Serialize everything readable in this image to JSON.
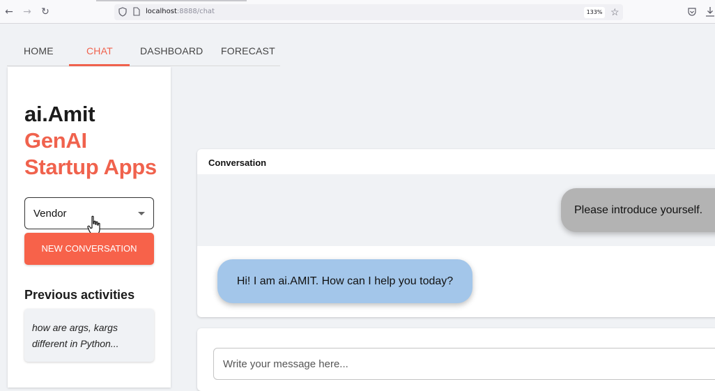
{
  "browser": {
    "url_host": "localhost",
    "url_path": ":8888/chat",
    "zoom": "133%",
    "icons": [
      "back-arrow-icon",
      "forward-arrow-icon",
      "reload-icon",
      "shield-icon",
      "page-icon",
      "star-icon",
      "pocket-icon",
      "download-icon"
    ]
  },
  "nav": {
    "tabs": [
      {
        "label": "HOME"
      },
      {
        "label": "CHAT"
      },
      {
        "label": "DASHBOARD"
      },
      {
        "label": "FORECAST"
      }
    ],
    "active_color": "#f0624d"
  },
  "sidebar": {
    "brand_line1": "ai.Amit",
    "brand_line2": "GenAI",
    "brand_line3": "Startup Apps",
    "selector_value": "Vendor",
    "new_conversation_label": "NEW CONVERSATION",
    "previous_title": "Previous activities",
    "previous_items": [
      {
        "text": "how are args, kargs different in Python..."
      }
    ]
  },
  "conversation": {
    "title": "Conversation",
    "user_message": "Please introduce yourself.",
    "bot_message": "Hi! I am ai.AMIT. How can I help you today?",
    "input_placeholder": "Write your message here..."
  },
  "colors": {
    "accent": "#f0624d",
    "user_bubble": "#b3b3b3",
    "bot_bubble": "#a3c6ea"
  }
}
